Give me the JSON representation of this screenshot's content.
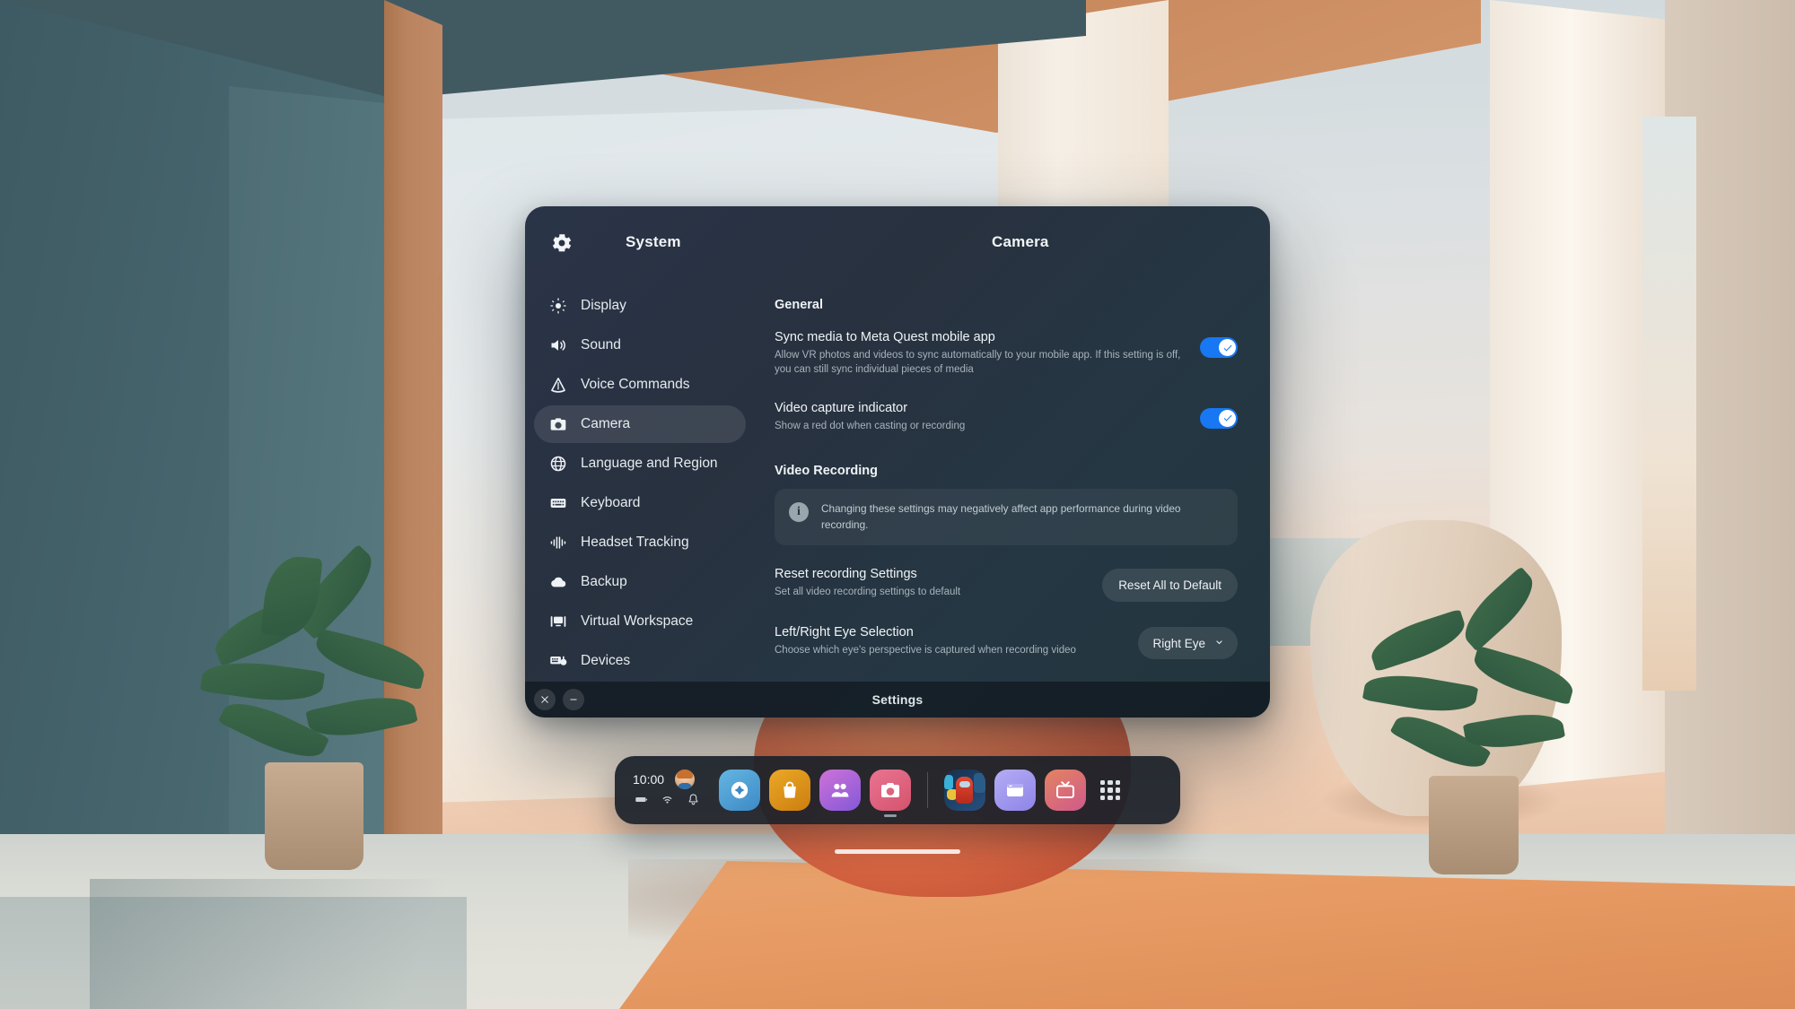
{
  "window": {
    "header": {
      "gear_icon": "gear-icon",
      "system_label": "System",
      "page_title": "Camera"
    },
    "sidebar": {
      "items": [
        {
          "label": "Display",
          "icon": "brightness-icon",
          "active": false
        },
        {
          "label": "Sound",
          "icon": "speaker-icon",
          "active": false
        },
        {
          "label": "Voice Commands",
          "icon": "voice-triangle-icon",
          "active": false
        },
        {
          "label": "Camera",
          "icon": "camera-icon",
          "active": true
        },
        {
          "label": "Language and Region",
          "icon": "globe-icon",
          "active": false
        },
        {
          "label": "Keyboard",
          "icon": "keyboard-icon",
          "active": false
        },
        {
          "label": "Headset Tracking",
          "icon": "waveform-icon",
          "active": false
        },
        {
          "label": "Backup",
          "icon": "cloud-icon",
          "active": false
        },
        {
          "label": "Virtual Workspace",
          "icon": "monitor-icon",
          "active": false
        },
        {
          "label": "Devices",
          "icon": "devices-icon",
          "active": false
        }
      ]
    },
    "content": {
      "general_section_title": "General",
      "sync_media": {
        "title": "Sync media to Meta Quest mobile app",
        "description": "Allow VR photos and videos to sync automatically to your mobile app. If this setting is off, you can still sync individual pieces of media",
        "toggle_state": "on"
      },
      "video_capture_indicator": {
        "title": "Video capture indicator",
        "description": "Show a red dot when casting or recording",
        "toggle_state": "on"
      },
      "video_recording_section_title": "Video Recording",
      "info_banner": {
        "icon": "info-icon",
        "text": "Changing these settings may negatively affect app performance during video recording."
      },
      "reset_recording": {
        "title": "Reset recording Settings",
        "description": "Set all video recording settings to default",
        "button_label": "Reset All to Default"
      },
      "eye_selection": {
        "title": "Left/Right Eye Selection",
        "description": "Choose which eye's perspective is captured when recording video",
        "selected_value": "Right Eye",
        "chevron_icon": "chevron-down-icon"
      }
    },
    "footer": {
      "close_icon": "close-icon",
      "minimize_icon": "minimize-icon",
      "title": "Settings"
    }
  },
  "dock": {
    "clock": "10:00",
    "avatar": "user-avatar",
    "status_icons": [
      "battery-icon",
      "wifi-icon",
      "bell-icon"
    ],
    "apps": [
      {
        "name": "explore-app",
        "icon": "compass-icon",
        "color1": "#5fb3e0",
        "color2": "#3f8fc9",
        "running": false
      },
      {
        "name": "store-app",
        "icon": "bag-icon",
        "color1": "#e8a425",
        "color2": "#d07f12",
        "running": false
      },
      {
        "name": "people-app",
        "icon": "people-icon",
        "color1": "#c86fd6",
        "color2": "#8a5fd6",
        "running": false
      },
      {
        "name": "camera-app",
        "icon": "camera-icon",
        "color1": "#e8708f",
        "color2": "#d8556f",
        "running": true
      },
      {
        "name": "game-app",
        "icon": "game-artwork",
        "color1": "#1f3a5f",
        "color2": "#2a4a7a",
        "running": false
      },
      {
        "name": "browser-app",
        "icon": "browser-icon",
        "color1": "#b0a8f0",
        "color2": "#8f86e8",
        "running": false
      },
      {
        "name": "tv-app",
        "icon": "tv-icon",
        "color1": "#e08060",
        "color2": "#d05a8a",
        "running": false
      }
    ],
    "app_library_icon": "grid-icon"
  },
  "colors": {
    "accent_blue": "#1877f2",
    "panel_bg": "#2a3448",
    "dock_bg": "#1b212a"
  }
}
